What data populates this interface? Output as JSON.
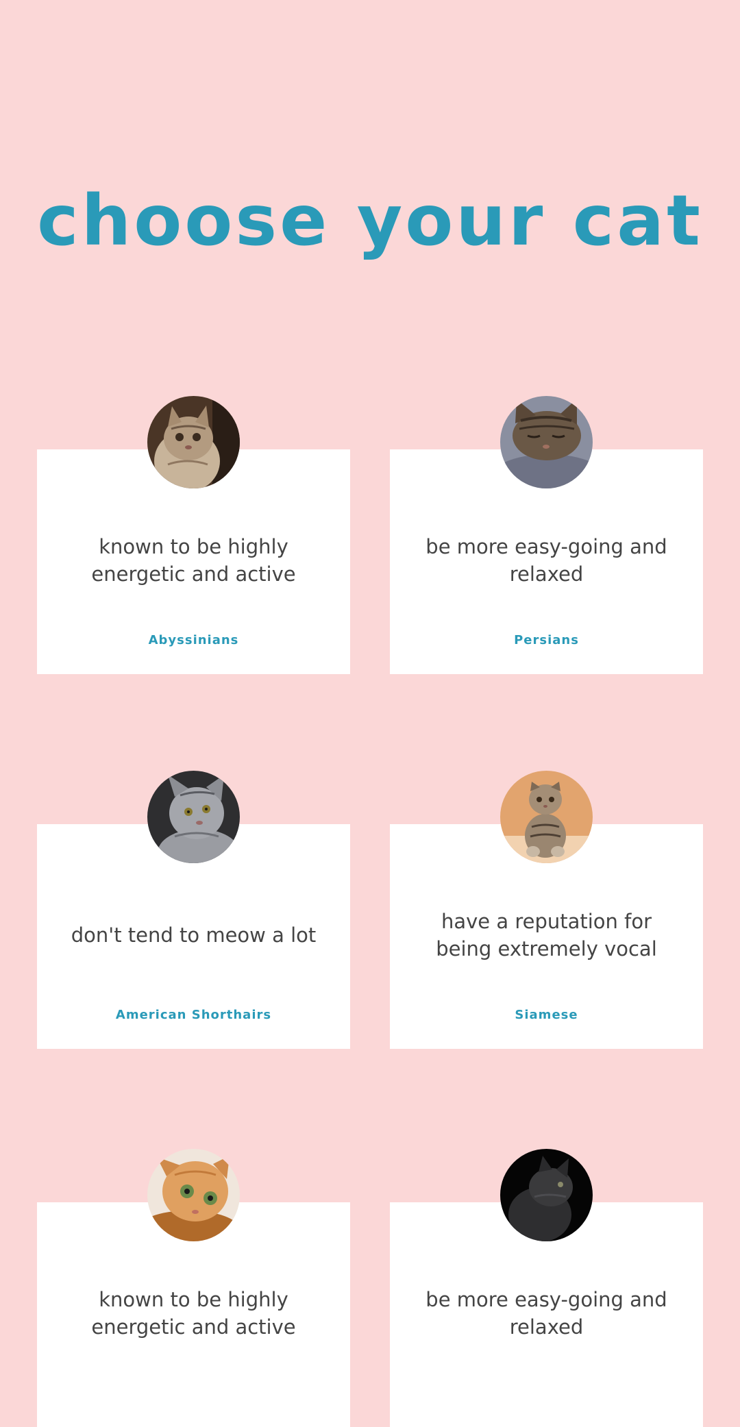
{
  "page": {
    "title": "choose your cat",
    "background_color": "#fbd7d7",
    "accent_color": "#2a9ab8"
  },
  "cards": [
    {
      "description": "known to be highly energetic and active",
      "breed": "Abyssinians",
      "image": "tabby-kitten-photo"
    },
    {
      "description": "be more easy-going and relaxed",
      "breed": "Persians",
      "image": "sleeping-tabby-cat-photo"
    },
    {
      "description": "don't tend to meow a lot",
      "breed": "American Shorthairs",
      "image": "gray-tabby-cat-photo"
    },
    {
      "description": "have a reputation for being extremely vocal",
      "breed": "Siamese",
      "image": "sitting-scottish-fold-cat-photo"
    },
    {
      "description": "known to be highly energetic and active",
      "breed": "",
      "image": "ginger-cat-photo"
    },
    {
      "description": "be more easy-going and relaxed",
      "breed": "",
      "image": "black-cat-photo"
    }
  ]
}
